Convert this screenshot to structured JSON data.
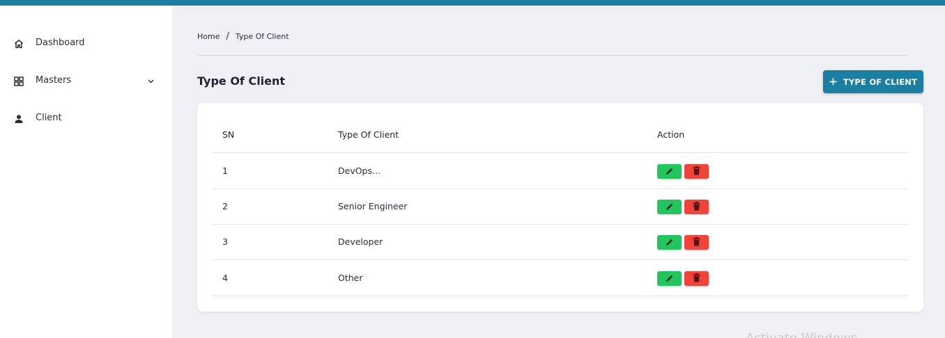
{
  "colors": {
    "accent": "#1a7fa0",
    "edit": "#22c55e",
    "delete": "#f04438"
  },
  "sidebar": {
    "items": [
      {
        "label": "Dashboard",
        "icon": "home-icon"
      },
      {
        "label": "Masters",
        "icon": "grid-icon",
        "expandable": true
      },
      {
        "label": "Client",
        "icon": "person-icon"
      }
    ]
  },
  "breadcrumb": {
    "home": "Home",
    "separator": "/",
    "current": "Type Of Client"
  },
  "page": {
    "title": "Type Of Client",
    "add_button_label": "TYPE OF CLIENT"
  },
  "table": {
    "columns": [
      "SN",
      "Type Of Client",
      "Action"
    ],
    "rows": [
      {
        "sn": "1",
        "type": "DevOps..."
      },
      {
        "sn": "2",
        "type": "Senior Engineer"
      },
      {
        "sn": "3",
        "type": "Developer"
      },
      {
        "sn": "4",
        "type": "Other"
      }
    ]
  },
  "watermark": "Activate Windows"
}
